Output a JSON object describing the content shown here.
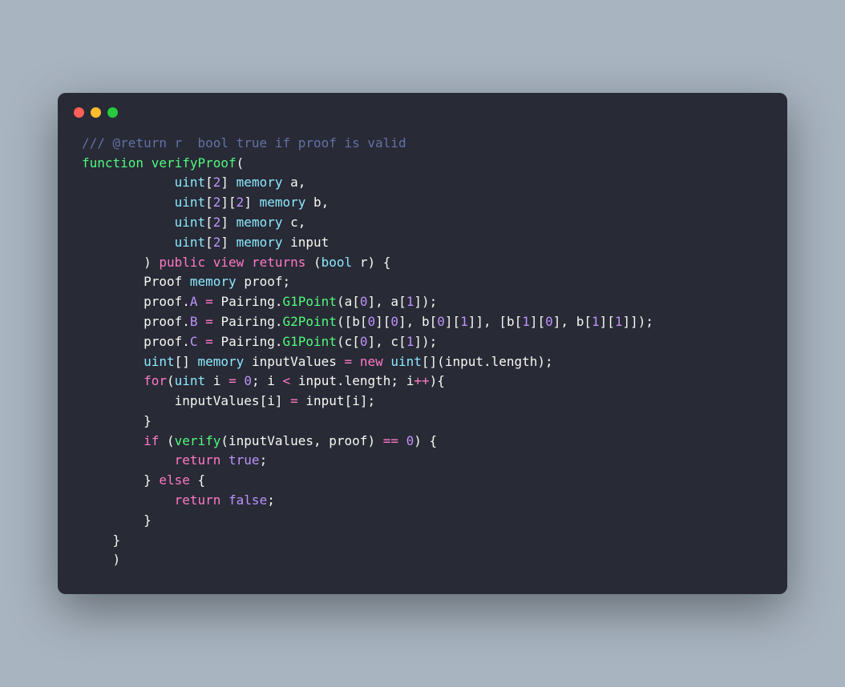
{
  "comment": "/// @return r  bool true if proof is valid",
  "line1": {
    "kw_function": "function",
    "name": "verifyProof",
    "paren": "("
  },
  "param_a": {
    "type": "uint",
    "dim": "2",
    "memory": "memory",
    "name": "a"
  },
  "param_b": {
    "type": "uint",
    "dim1": "2",
    "dim2": "2",
    "memory": "memory",
    "name": "b"
  },
  "param_c": {
    "type": "uint",
    "dim": "2",
    "memory": "memory",
    "name": "c"
  },
  "param_input": {
    "type": "uint",
    "dim": "2",
    "memory": "memory",
    "name": "input"
  },
  "sig": {
    "public": "public",
    "view": "view",
    "returns": "returns",
    "bool": "bool",
    "r": "r"
  },
  "proof_decl": {
    "type": "Proof",
    "memory": "memory",
    "name": "proof"
  },
  "proofA": {
    "lhs": "proof",
    "dot": ".",
    "A": "A",
    "eq": "=",
    "Pairing": "Pairing",
    "G1": "G1Point",
    "a": "a",
    "i0": "0",
    "i1": "1"
  },
  "proofB": {
    "lhs": "proof",
    "B": "B",
    "eq": "=",
    "Pairing": "Pairing",
    "G2": "G2Point",
    "b": "b",
    "i0": "0",
    "i1": "1"
  },
  "proofC": {
    "lhs": "proof",
    "C": "C",
    "eq": "=",
    "Pairing": "Pairing",
    "G1": "G1Point",
    "c": "c",
    "i0": "0",
    "i1": "1"
  },
  "inputValues_decl": {
    "uint": "uint",
    "memory": "memory",
    "name": "inputValues",
    "new": "new",
    "input": "input",
    "length": "length"
  },
  "forloop": {
    "for": "for",
    "uint": "uint",
    "i": "i",
    "zero": "0",
    "lt": "<",
    "input": "input",
    "length": "length",
    "inc": "++"
  },
  "assign": {
    "lhs": "inputValues",
    "i": "i",
    "rhs": "input"
  },
  "ifline": {
    "if": "if",
    "verify": "verify",
    "inputValues": "inputValues",
    "proof": "proof",
    "eq": "==",
    "zero": "0"
  },
  "ret_true": {
    "return": "return",
    "val": "true"
  },
  "elseline": {
    "else": "else"
  },
  "ret_false": {
    "return": "return",
    "val": "false"
  }
}
